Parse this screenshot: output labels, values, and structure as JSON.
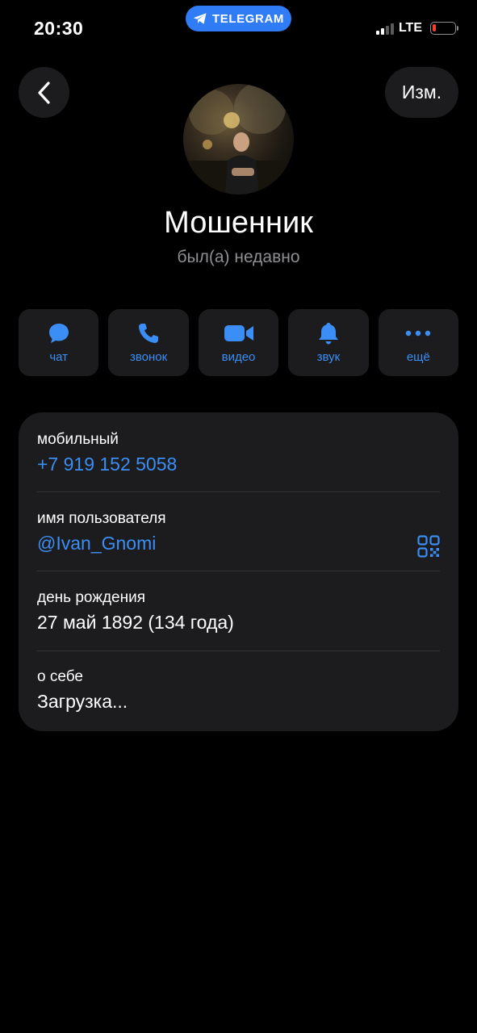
{
  "status_bar": {
    "time": "20:30",
    "app_pill": "TELEGRAM",
    "network": "LTE",
    "battery_level": 0.15,
    "battery_color": "#ff3b30"
  },
  "header": {
    "back_icon": "chevron-left-icon",
    "edit_label": "Изм."
  },
  "profile": {
    "name": "Мошенник",
    "status": "был(а) недавно"
  },
  "actions": [
    {
      "label": "чат",
      "icon": "chat-bubble-icon"
    },
    {
      "label": "звонок",
      "icon": "phone-icon"
    },
    {
      "label": "видео",
      "icon": "video-camera-icon"
    },
    {
      "label": "звук",
      "icon": "bell-icon"
    },
    {
      "label": "ещё",
      "icon": "more-dots-icon"
    }
  ],
  "info": {
    "mobile_label": "мобильный",
    "mobile_value": "+7 919 152 5058",
    "username_label": "имя пользователя",
    "username_value": "@Ivan_Gnomi",
    "birthday_label": "день рождения",
    "birthday_value": "27 май 1892 (134 года)",
    "about_label": "о себе",
    "about_value": "Загрузка..."
  },
  "colors": {
    "accent": "#3b8ef5",
    "pill": "#2f7cf6",
    "card": "#1c1c1e",
    "background": "#000000",
    "secondary_text": "#8e8e93"
  }
}
